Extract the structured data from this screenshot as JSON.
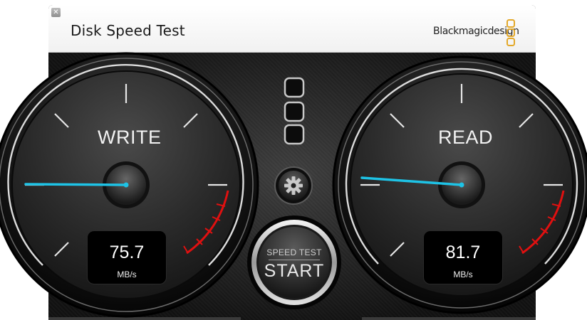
{
  "window": {
    "title": "Disk Speed Test",
    "brand": "Blackmagicdesign"
  },
  "icons": {
    "close": "close-icon",
    "settings": "gear-icon",
    "brand_logo": "blackmagic-logo-icon"
  },
  "gauges": {
    "write": {
      "label": "WRITE",
      "value": "75.7",
      "unit": "MB/s",
      "needle_color": "#1ec3e6"
    },
    "read": {
      "label": "READ",
      "value": "81.7",
      "unit": "MB/s",
      "needle_color": "#1ec3e6"
    }
  },
  "start_button": {
    "caption": "SPEED TEST",
    "label": "START"
  },
  "colors": {
    "redline": "#e01010",
    "accent": "#1ec3e6",
    "text": "#f2f2f2"
  }
}
